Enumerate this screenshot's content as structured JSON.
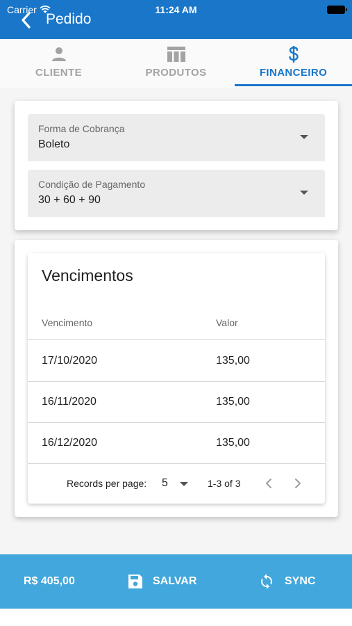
{
  "status_bar": {
    "carrier": "Carrier",
    "time": "11:24 AM"
  },
  "header": {
    "title": "Pedido"
  },
  "tabs": [
    {
      "label": "CLIENTE",
      "icon": "person-icon",
      "active": false
    },
    {
      "label": "PRODUTOS",
      "icon": "table-icon",
      "active": false
    },
    {
      "label": "FINANCEIRO",
      "icon": "dollar-icon",
      "active": true
    }
  ],
  "form": {
    "forma_cobranca": {
      "label": "Forma de Cobrança",
      "value": "Boleto"
    },
    "condicao_pagamento": {
      "label": "Condição de Pagamento",
      "value": "30 + 60 + 90"
    }
  },
  "vencimentos": {
    "title": "Vencimentos",
    "columns": [
      "Vencimento",
      "Valor"
    ],
    "rows": [
      [
        "17/10/2020",
        "135,00"
      ],
      [
        "16/11/2020",
        "135,00"
      ],
      [
        "16/12/2020",
        "135,00"
      ]
    ],
    "pagination": {
      "records_per_page_label": "Records per page:",
      "records_per_page": "5",
      "range": "1-3 of 3"
    }
  },
  "footer": {
    "total": "R$ 405,00",
    "save_label": "SALVAR",
    "sync_label": "SYNC"
  },
  "colors": {
    "primary": "#1976c9",
    "footer": "#41a7dc"
  }
}
